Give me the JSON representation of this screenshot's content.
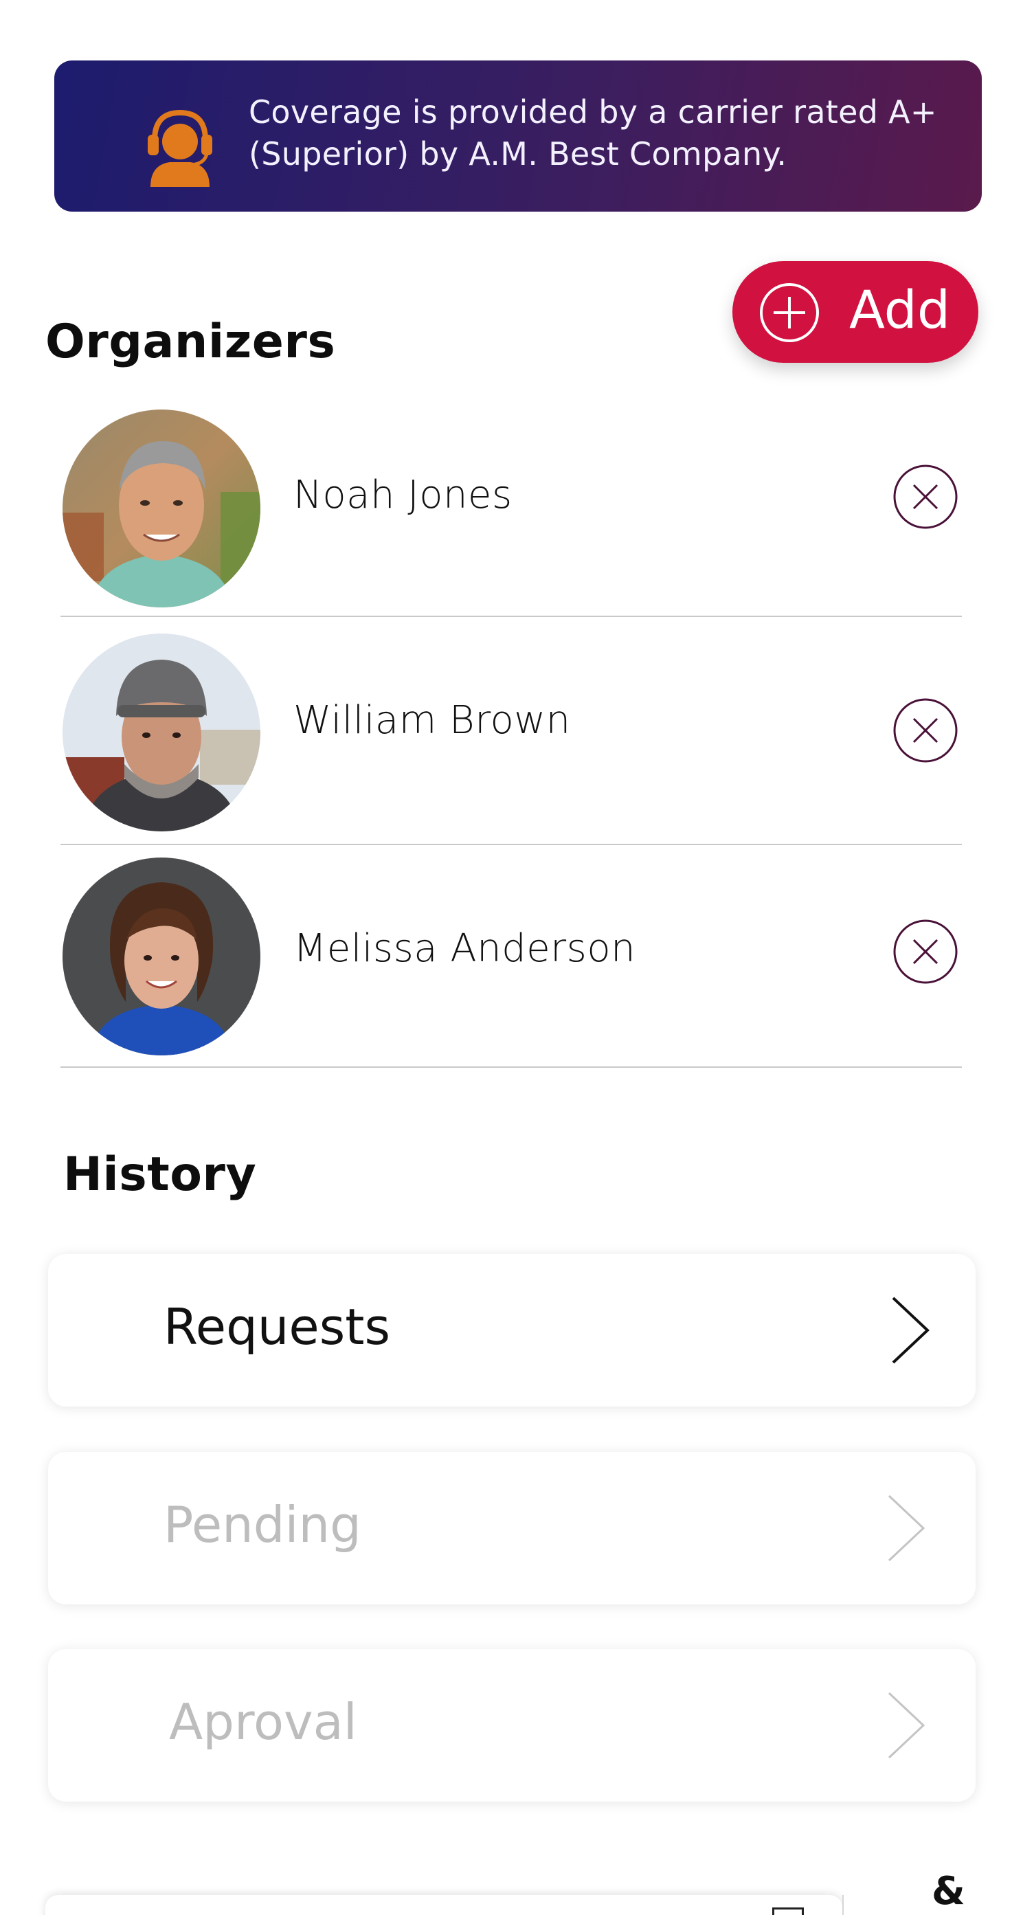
{
  "banner": {
    "icon": "support-agent-icon",
    "text": "Coverage is provided by a carrier rated A+ (Superior) by A.M. Best Company.",
    "colors": {
      "gradient_start": "#1d1c6e",
      "gradient_end": "#5a1a4c",
      "icon": "#e07a1c"
    }
  },
  "organizers": {
    "title": "Organizers",
    "add_button": {
      "label": "Add",
      "icon": "plus-circle-icon",
      "color": "#d1113f"
    },
    "items": [
      {
        "name": "Noah Jones",
        "remove_icon": "close-circle-icon"
      },
      {
        "name": "William Brown",
        "remove_icon": "close-circle-icon"
      },
      {
        "name": "Melissa Anderson",
        "remove_icon": "close-circle-icon"
      }
    ]
  },
  "history": {
    "title": "History",
    "items": [
      {
        "label": "Requests",
        "state": "enabled",
        "icon": "chevron-right-icon"
      },
      {
        "label": "Pending",
        "state": "disabled",
        "icon": "chevron-right-icon"
      },
      {
        "label": "Aproval",
        "state": "disabled",
        "icon": "chevron-right-icon"
      }
    ]
  },
  "bottom": {
    "partial_text": "& Eve"
  },
  "colors": {
    "remove_icon": "#4a1238",
    "disabled_text": "#bdbdbd",
    "divider": "#c9c9c9"
  }
}
